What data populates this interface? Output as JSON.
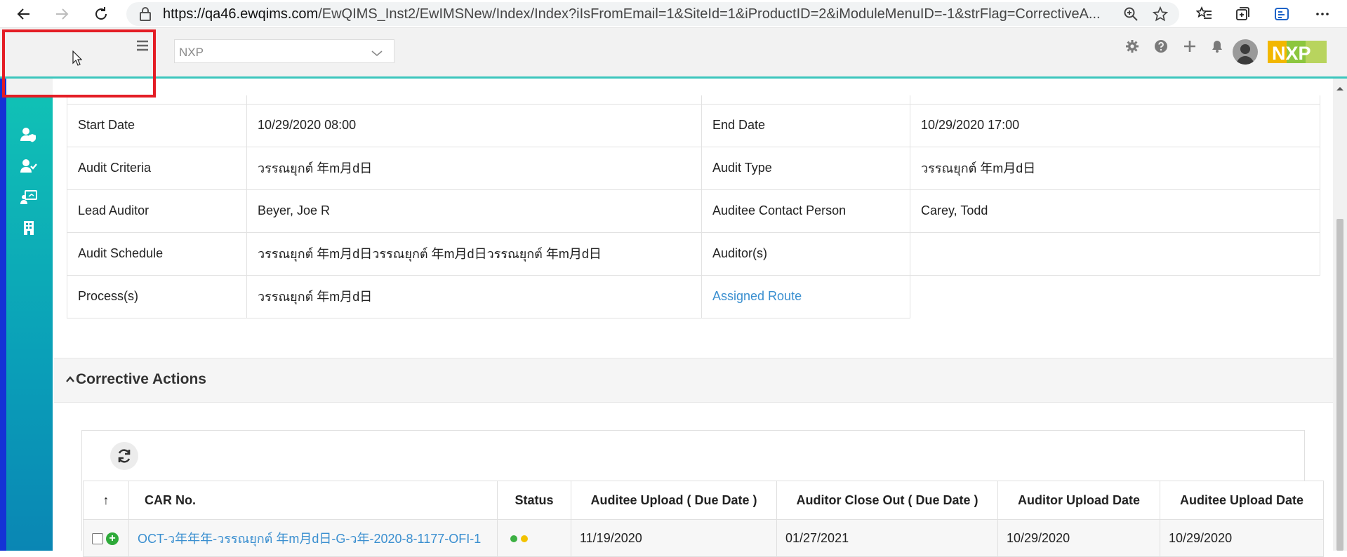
{
  "browser": {
    "url_host": "https://qa46.ewqims.com",
    "url_rest": "/EwQIMS_Inst2/EwIMSNew/Index/Index?iIsFromEmail=1&SiteId=1&iProductID=2&iModuleMenuID=-1&strFlag=CorrectiveA..."
  },
  "header": {
    "site_value": "NXP",
    "logo_text": "NXP"
  },
  "audit_info": {
    "start_date_label": "Start Date",
    "start_date_value": "10/29/2020 08:00",
    "end_date_label": "End Date",
    "end_date_value": "10/29/2020 17:00",
    "criteria_label": "Audit Criteria",
    "criteria_value": "วรรณยุกต์ 年m月d日",
    "type_label": "Audit Type",
    "type_value": "วรรณยุกต์ 年m月d日",
    "lead_label": "Lead Auditor",
    "lead_value": "Beyer, Joe R",
    "contact_label": "Auditee Contact Person",
    "contact_value": "Carey, Todd",
    "schedule_label": "Audit Schedule",
    "schedule_value": "วรรณยุกต์ 年m月d日วรรณยุกต์ 年m月d日วรรณยุกต์ 年m月d日",
    "auditors_label": "Auditor(s)",
    "auditors_value": "",
    "process_label": "Process(s)",
    "process_value": "วรรณยุกต์ 年m月d日",
    "assigned_route_link": "Assigned Route"
  },
  "corrective_actions": {
    "title": "Corrective Actions",
    "columns": {
      "sort": "↑",
      "car_no": "CAR No.",
      "status": "Status",
      "auditee_upload_due": "Auditee Upload ( Due Date )",
      "auditor_closeout_due": "Auditor Close Out ( Due Date )",
      "auditor_upload_date": "Auditor Upload Date",
      "auditee_upload_date": "Auditee Upload Date"
    },
    "rows": [
      {
        "car_no": "OCT-ว年年年-วรรณยุกต์ 年m月d日-G-ว年-2020-8-1177-OFI-1",
        "status_colors": [
          "#3cb043",
          "#f2c200"
        ],
        "auditee_upload_due": "11/19/2020",
        "auditor_closeout_due": "01/27/2021",
        "auditor_upload_date": "10/29/2020",
        "auditee_upload_date": "10/29/2020"
      }
    ]
  },
  "colors": {
    "accent": "#3cc6bd",
    "sidebar_edge": "#1432d6",
    "link": "#3a8fd0",
    "highlight": "#e41d25"
  }
}
